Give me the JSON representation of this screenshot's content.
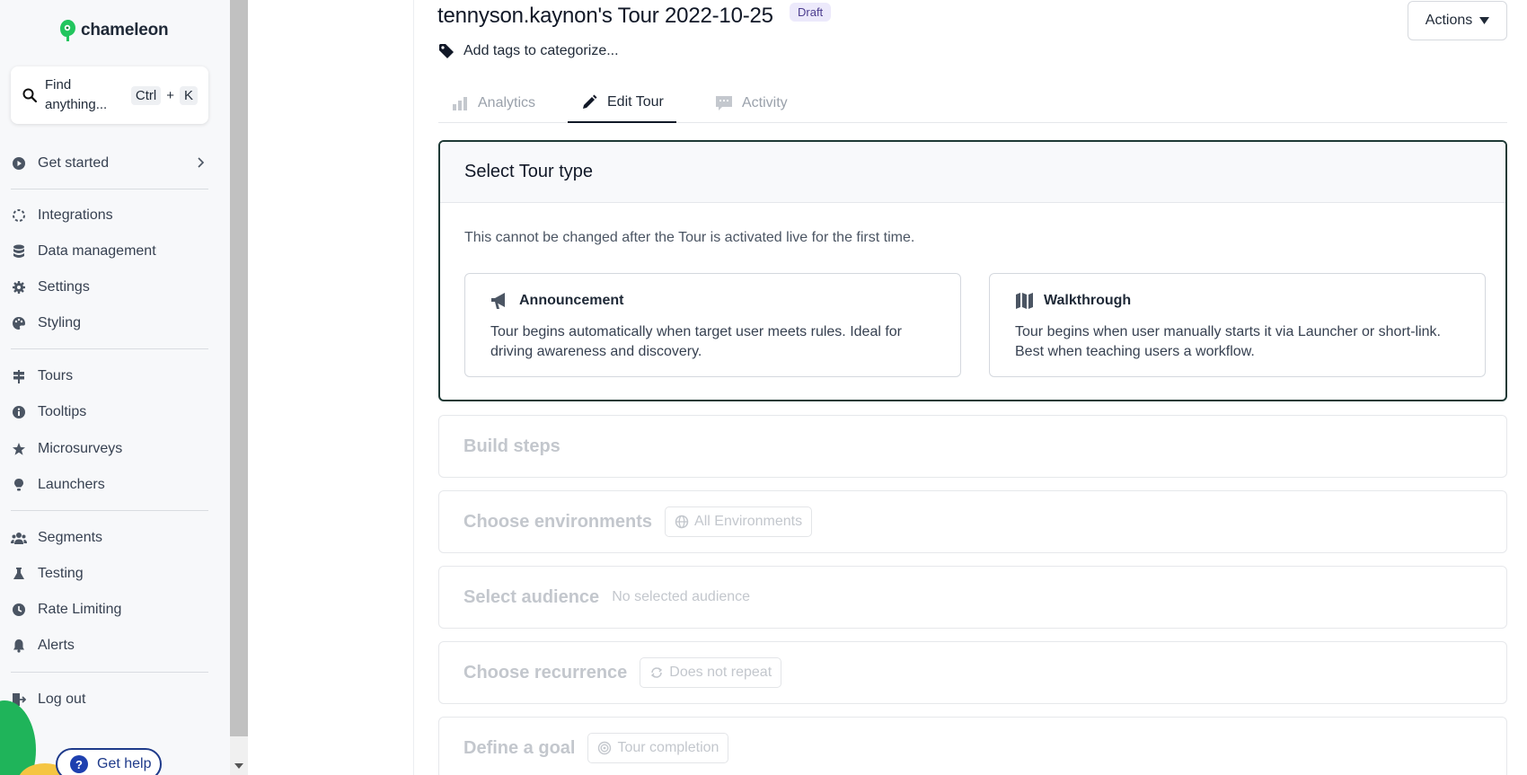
{
  "brand": {
    "name": "chameleon"
  },
  "search": {
    "placeholder": "Find anything...",
    "shortcut_key1": "Ctrl",
    "shortcut_plus": "+",
    "shortcut_key2": "K"
  },
  "sidebar": {
    "items": [
      {
        "label": "Get started",
        "icon": "play-circle-icon"
      },
      {
        "label": "Integrations",
        "icon": "integrations-icon"
      },
      {
        "label": "Data management",
        "icon": "database-icon"
      },
      {
        "label": "Settings",
        "icon": "gear-icon"
      },
      {
        "label": "Styling",
        "icon": "palette-icon"
      },
      {
        "label": "Tours",
        "icon": "signpost-icon"
      },
      {
        "label": "Tooltips",
        "icon": "info-icon"
      },
      {
        "label": "Microsurveys",
        "icon": "star-icon"
      },
      {
        "label": "Launchers",
        "icon": "lightbulb-icon"
      },
      {
        "label": "Segments",
        "icon": "users-icon"
      },
      {
        "label": "Testing",
        "icon": "flask-icon"
      },
      {
        "label": "Rate Limiting",
        "icon": "clock-icon"
      },
      {
        "label": "Alerts",
        "icon": "bell-icon"
      },
      {
        "label": "Log out",
        "icon": "logout-icon"
      }
    ],
    "help_label": "Get help"
  },
  "header": {
    "title": "tennyson.kaynon's Tour 2022-10-25",
    "status": "Draft",
    "actions_label": "Actions",
    "tags_placeholder": "Add tags to categorize..."
  },
  "tabs": [
    {
      "label": "Analytics",
      "icon": "bar-chart-icon",
      "active": false
    },
    {
      "label": "Edit Tour",
      "icon": "pencil-icon",
      "active": true
    },
    {
      "label": "Activity",
      "icon": "chat-icon",
      "active": false
    }
  ],
  "tour_type": {
    "heading": "Select Tour type",
    "note": "This cannot be changed after the Tour is activated live for the first time.",
    "options": [
      {
        "title": "Announcement",
        "icon": "megaphone-icon",
        "description": "Tour begins automatically when target user meets rules. Ideal for driving awareness and discovery."
      },
      {
        "title": "Walkthrough",
        "icon": "map-icon",
        "description": "Tour begins when user manually starts it via Launcher or short-link. Best when teaching users a workflow."
      }
    ]
  },
  "sections": {
    "build_steps": {
      "title": "Build steps"
    },
    "environments": {
      "title": "Choose environments",
      "chip": "All Environments"
    },
    "audience": {
      "title": "Select audience",
      "value": "No selected audience"
    },
    "recurrence": {
      "title": "Choose recurrence",
      "chip": "Does not repeat"
    },
    "goal": {
      "title": "Define a goal",
      "chip": "Tour completion"
    }
  },
  "colors": {
    "accent": "#1f3a36",
    "brand_green": "#1fb45a",
    "help_blue": "#1e3a8a"
  }
}
